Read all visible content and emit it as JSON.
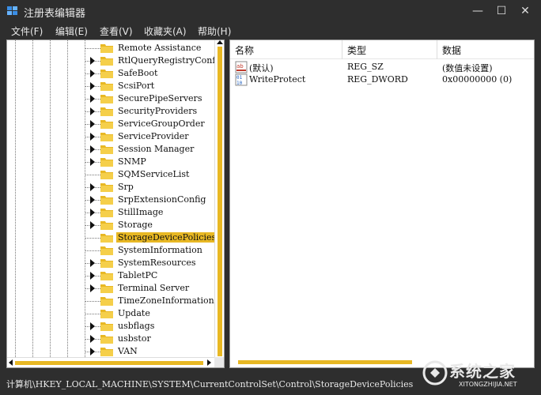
{
  "window": {
    "title": "注册表编辑器",
    "controls": {
      "minimize": "—",
      "maximize": "☐",
      "close": "✕"
    }
  },
  "menu": [
    {
      "label": "文件(F)"
    },
    {
      "label": "编辑(E)"
    },
    {
      "label": "查看(V)"
    },
    {
      "label": "收藏夹(A)"
    },
    {
      "label": "帮助(H)"
    }
  ],
  "tree": {
    "items": [
      {
        "label": "Remote Assistance",
        "expandable": false
      },
      {
        "label": "RtlQueryRegistryConf",
        "expandable": true
      },
      {
        "label": "SafeBoot",
        "expandable": true
      },
      {
        "label": "ScsiPort",
        "expandable": true
      },
      {
        "label": "SecurePipeServers",
        "expandable": true
      },
      {
        "label": "SecurityProviders",
        "expandable": true
      },
      {
        "label": "ServiceGroupOrder",
        "expandable": true
      },
      {
        "label": "ServiceProvider",
        "expandable": true
      },
      {
        "label": "Session Manager",
        "expandable": true
      },
      {
        "label": "SNMP",
        "expandable": true
      },
      {
        "label": "SQMServiceList",
        "expandable": false
      },
      {
        "label": "Srp",
        "expandable": true
      },
      {
        "label": "SrpExtensionConfig",
        "expandable": true
      },
      {
        "label": "StillImage",
        "expandable": true
      },
      {
        "label": "Storage",
        "expandable": true
      },
      {
        "label": "StorageDevicePolicies",
        "expandable": false,
        "selected": true
      },
      {
        "label": "SystemInformation",
        "expandable": false
      },
      {
        "label": "SystemResources",
        "expandable": true
      },
      {
        "label": "TabletPC",
        "expandable": true
      },
      {
        "label": "Terminal Server",
        "expandable": true
      },
      {
        "label": "TimeZoneInformation",
        "expandable": false
      },
      {
        "label": "Update",
        "expandable": false
      },
      {
        "label": "usbflags",
        "expandable": true
      },
      {
        "label": "usbstor",
        "expandable": true
      },
      {
        "label": "VAN",
        "expandable": true
      }
    ]
  },
  "values": {
    "columns": {
      "name": "名称",
      "type": "类型",
      "data": "数据"
    },
    "rows": [
      {
        "icon": "string-value-icon",
        "name": "(默认)",
        "type": "REG_SZ",
        "data": "(数值未设置)"
      },
      {
        "icon": "binary-value-icon",
        "name": "WriteProtect",
        "type": "REG_DWORD",
        "data": "0x00000000 (0)"
      }
    ]
  },
  "status": {
    "path": "计算机\\HKEY_LOCAL_MACHINE\\SYSTEM\\CurrentControlSet\\Control\\StorageDevicePolicies"
  },
  "watermark": {
    "text": "系统之家",
    "url": "XITONGZHIJIA.NET"
  },
  "colors": {
    "accent": "#e8b824",
    "chrome": "#2e2e2e",
    "folder": "#e8b824"
  }
}
